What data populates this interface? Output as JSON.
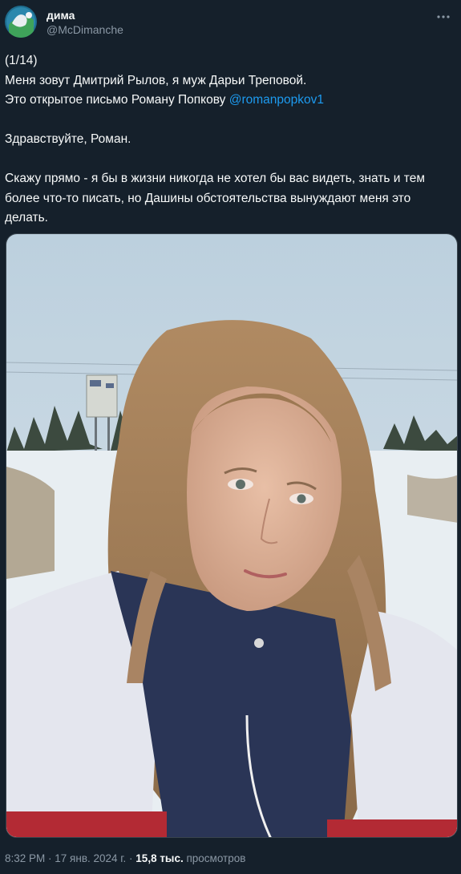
{
  "author": {
    "display_name": "дима",
    "handle": "@McDimanche"
  },
  "tweet": {
    "line1": "(1/14)",
    "line2": "Меня зовут Дмитрий Рылов, я муж Дарьи Треповой.",
    "line3_text": "Это открытое письмо Роману Попкову ",
    "line3_mention": "@romanpopkov1",
    "line4": "Здравствуйте, Роман.",
    "line5a": "Скажу прямо - я бы в жизни никогда не хотел бы вас видеть, знать и тем",
    "line5b": "более что-то писать, но Дашины обстоятельства вынуждают меня это",
    "line5c": "делать."
  },
  "footer": {
    "time": "8:32 PM",
    "sep1": " · ",
    "date": "17 янв. 2024 г.",
    "sep2": " · ",
    "views": "15,8 тыс.",
    "views_label": " просмотров"
  },
  "icons": {
    "more": "more-dots-icon"
  }
}
